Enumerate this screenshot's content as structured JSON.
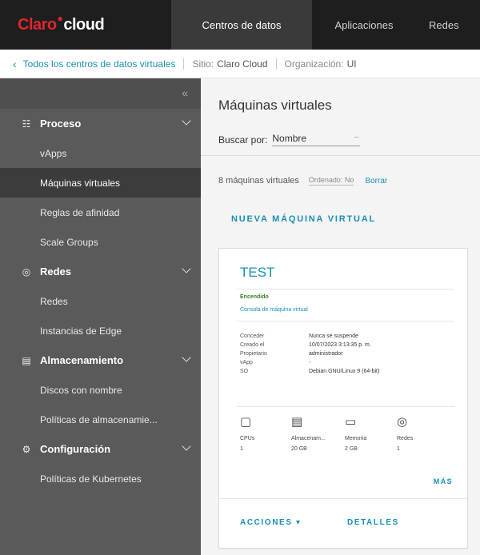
{
  "logo": {
    "brand": "Claro",
    "product": "cloud"
  },
  "topnav": [
    {
      "label": "Centros de datos"
    },
    {
      "label": "Aplicaciones"
    },
    {
      "label": "Redes"
    }
  ],
  "breadcrumb": {
    "back": "Todos los centros de datos virtuales",
    "site_label": "Sitio:",
    "site_value": "Claro Cloud",
    "org_label": "Organización:",
    "org_value": "UI"
  },
  "sidebar": {
    "collapse": "«",
    "sections": [
      {
        "label": "Proceso",
        "icon": "grid-icon",
        "glyph": "☷",
        "items": [
          "vApps",
          "Máquinas virtuales",
          "Reglas de afinidad",
          "Scale Groups"
        ]
      },
      {
        "label": "Redes",
        "icon": "network-icon",
        "glyph": "◎",
        "items": [
          "Redes",
          "Instancias de Edge"
        ]
      },
      {
        "label": "Almacenamiento",
        "icon": "storage-icon",
        "glyph": "▤",
        "items": [
          "Discos con nombre",
          "Políticas de almacenamie..."
        ]
      },
      {
        "label": "Configuración",
        "icon": "gear-icon",
        "glyph": "⚙",
        "items": [
          "Políticas de Kubernetes"
        ]
      }
    ],
    "active_item": "Máquinas virtuales"
  },
  "main": {
    "title": "Máquinas virtuales",
    "search_by_label": "Buscar por:",
    "search_by_value": "Nombre",
    "count_text": "8 máquinas virtuales",
    "sort_label": "Ordenado: No",
    "more_filters": "Borrar",
    "new_vm_label": "NUEVA MÁQUINA VIRTUAL"
  },
  "vm_card": {
    "name": "TEST",
    "status": "Encendido",
    "console": "Consola de máquina virtual",
    "properties": [
      {
        "key": "Conceder",
        "value": "Nunca se suspende"
      },
      {
        "key": "Creado el",
        "value": "10/07/2023 3:13:35 p. m."
      },
      {
        "key": "Propietario",
        "value": "administrador"
      },
      {
        "key": "vApp",
        "value": "-"
      },
      {
        "key": "SO",
        "value": "Debian GNU/Linux 9 (64-bit)"
      }
    ],
    "resources": [
      {
        "label": "CPUs",
        "value": "1",
        "icon": "cpu-icon",
        "glyph": "▢"
      },
      {
        "label": "Almacenam...",
        "value": "20 GB",
        "icon": "storage-icon",
        "glyph": "▤"
      },
      {
        "label": "Memoria",
        "value": "2 GB",
        "icon": "memory-icon",
        "glyph": "▭"
      },
      {
        "label": "Redes",
        "value": "1",
        "icon": "network-icon",
        "glyph": "◎"
      }
    ],
    "more_label": "MÁS",
    "actions_label": "ACCIONES",
    "details_label": "DETALLES"
  },
  "colors": {
    "topbar": "#1e1e1e",
    "brand_red": "#e0262d",
    "accent": "#1a8fb5",
    "sidebar": "#5a5a5a",
    "sidebar_active": "#3c3c3c"
  }
}
